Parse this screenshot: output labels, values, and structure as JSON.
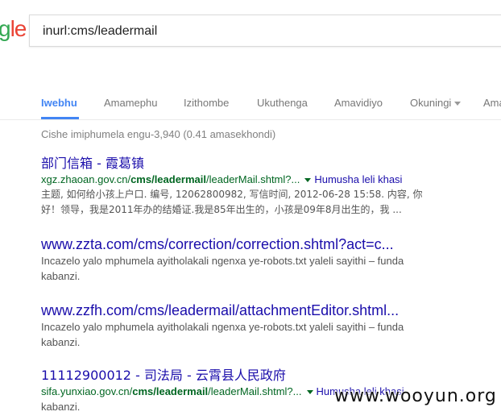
{
  "search": {
    "query": "inurl:cms/leadermail",
    "logo_fragment": {
      "g": "g",
      "e": "le"
    }
  },
  "tabs": [
    {
      "label": "Iwebhu",
      "active": true
    },
    {
      "label": "Amamephu"
    },
    {
      "label": "Izithombe"
    },
    {
      "label": "Ukuthenga"
    },
    {
      "label": "Amavidiyo"
    },
    {
      "label": "Okuningi",
      "dropdown": true
    },
    {
      "label": "Ama"
    }
  ],
  "stats": "Cishe imiphumela engu-3,940 (0.41 amasekhondi)",
  "results": [
    {
      "title": "部门信箱 - 霞葛镇",
      "url_prefix": "xgz.zhaoan.gov.cn/",
      "url_bold": "cms/leadermail",
      "url_suffix": "/leaderMail.shtml?...",
      "translate": "Humusha leli khasi",
      "snippet_1": "主题, 如何给小孩上户口. 编号, 12062800982, 写信时间, 2012-06-28 15:58. 内容, 你",
      "snippet_2": "好！领导，我是2011年办的结婚证.我是85年出生的，小孩是09年8月出生的，我 ..."
    },
    {
      "title": "www.zzta.com/cms/correction/correction.shtml?act=c...",
      "snippet_1": "Incazelo yalo mphumela ayitholakali ngenxa ye-robots.txt yaleli sayithi – funda",
      "snippet_2": "kabanzi."
    },
    {
      "title": "www.zzfh.com/cms/leadermail/attachmentEditor.shtml...",
      "snippet_1": "Incazelo yalo mphumela ayitholakali ngenxa ye-robots.txt yaleli sayithi – funda",
      "snippet_2": "kabanzi."
    },
    {
      "title": "11112900012 - 司法局 - 云霄县人民政府",
      "url_prefix": "sifa.yunxiao.gov.cn/",
      "url_bold": "cms/leadermail",
      "url_suffix": "/leaderMail.shtml?...",
      "translate": "Humusha leli khasi",
      "snippet_1": "kabanzi."
    }
  ],
  "watermark": "www.wooyun.org",
  "colors": {
    "link": "#1a0dab",
    "url": "#006621",
    "tab_active": "#4285f4",
    "snippet": "#545454"
  }
}
